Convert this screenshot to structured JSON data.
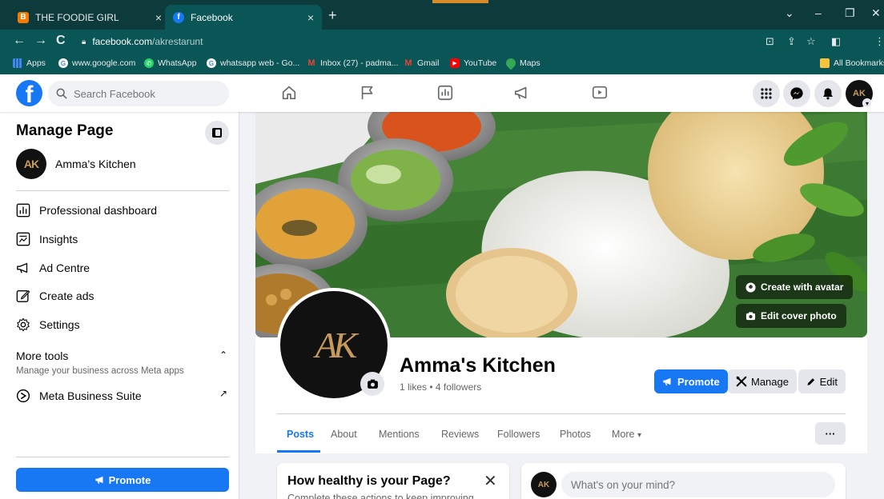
{
  "browser": {
    "tabs": [
      {
        "title": "THE FOODIE GIRL",
        "favicon_letter": "B",
        "favicon_color": "#f57c00",
        "active": false
      },
      {
        "title": "Facebook",
        "favicon_letter": "f",
        "favicon_color": "#1877f2",
        "active": true
      }
    ],
    "close_glyph": "×",
    "new_tab_glyph": "+",
    "url_host": "facebook.com",
    "url_path": "/akrestarunt",
    "bookmarks": [
      {
        "label": "Apps",
        "icon": "apps-grid-icon"
      },
      {
        "label": "www.google.com",
        "icon": "google-icon"
      },
      {
        "label": "WhatsApp",
        "icon": "whatsapp-icon"
      },
      {
        "label": "whatsapp web - Go...",
        "icon": "google-icon"
      },
      {
        "label": "Inbox (27) - padma...",
        "icon": "gmail-icon"
      },
      {
        "label": "Gmail",
        "icon": "gmail-icon"
      },
      {
        "label": "YouTube",
        "icon": "youtube-icon"
      },
      {
        "label": "Maps",
        "icon": "maps-icon"
      }
    ],
    "all_bookmarks": "All Bookmarks"
  },
  "fbnav": {
    "search_placeholder": "Search Facebook",
    "avatar_text": "AK"
  },
  "sidebar": {
    "title": "Manage Page",
    "page_name": "Amma's Kitchen",
    "items": [
      {
        "label": "Professional dashboard",
        "icon": "dashboard-icon"
      },
      {
        "label": "Insights",
        "icon": "insights-icon"
      },
      {
        "label": "Ad Centre",
        "icon": "megaphone-icon"
      },
      {
        "label": "Create ads",
        "icon": "pencil-icon"
      },
      {
        "label": "Settings",
        "icon": "gear-icon"
      }
    ],
    "more_tools": "More tools",
    "more_tools_sub": "Manage your business across Meta apps",
    "meta_business": "Meta Business Suite",
    "promote": "Promote"
  },
  "cover": {
    "create_avatar": "Create with avatar",
    "edit_cover": "Edit cover photo"
  },
  "page": {
    "name": "Amma's Kitchen",
    "stats": "1 likes • 4 followers",
    "logo_text": "AK",
    "buttons": {
      "promote": "Promote",
      "manage": "Manage",
      "edit": "Edit"
    },
    "tabs": [
      "Posts",
      "About",
      "Mentions",
      "Reviews",
      "Followers",
      "Photos",
      "More"
    ],
    "more_caret": "▾",
    "dots": "···"
  },
  "health_card": {
    "title": "How healthy is your Page?",
    "subtitle": "Complete these actions to keep improving"
  },
  "composer": {
    "placeholder": "What's on your mind?",
    "avatar_text": "AK"
  }
}
